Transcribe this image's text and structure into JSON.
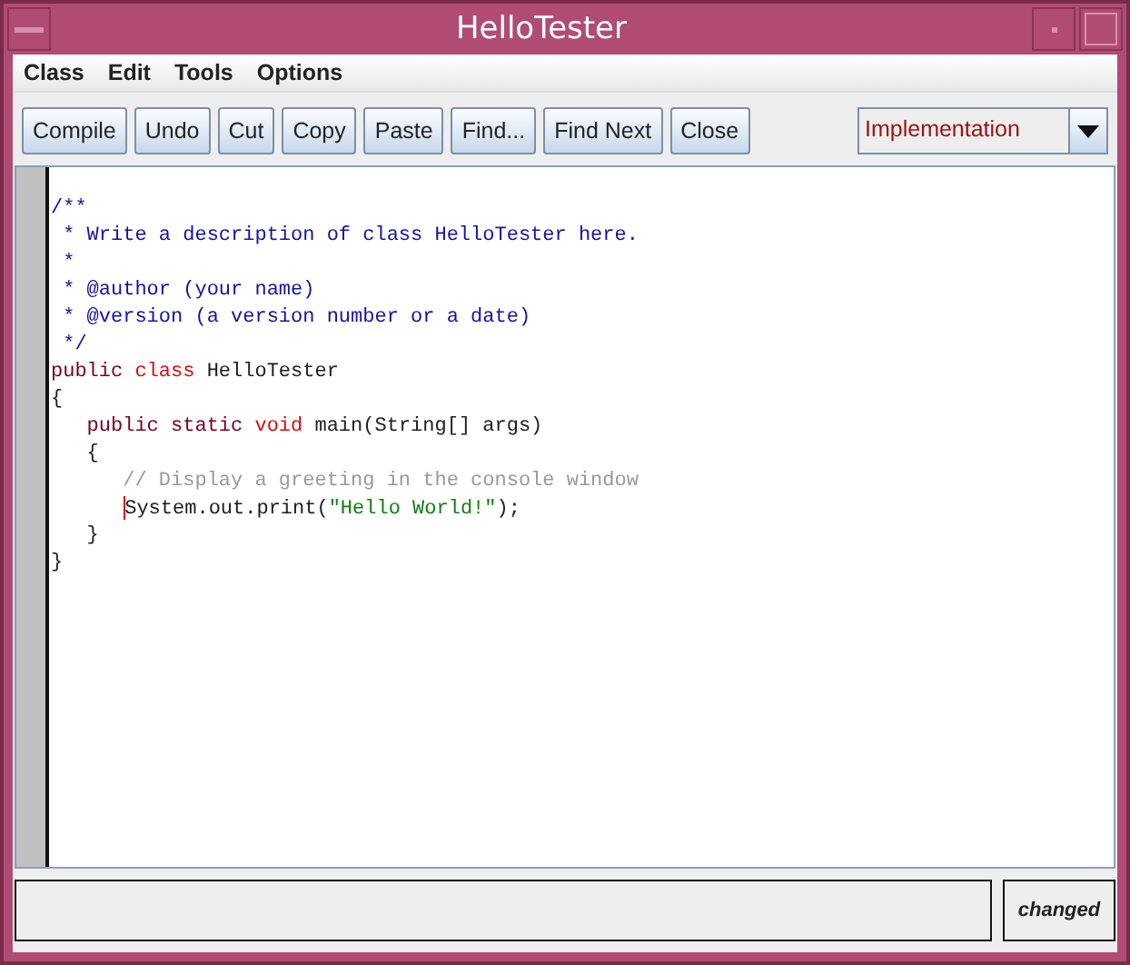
{
  "window": {
    "title": "HelloTester"
  },
  "menu": [
    "Class",
    "Edit",
    "Tools",
    "Options"
  ],
  "toolbar": [
    "Compile",
    "Undo",
    "Cut",
    "Copy",
    "Paste",
    "Find...",
    "Find Next",
    "Close"
  ],
  "view_selector": {
    "value": "Implementation"
  },
  "code": [
    {
      "caret": false,
      "tokens": [
        {
          "kind": "doc",
          "text": "/**"
        }
      ]
    },
    {
      "caret": false,
      "tokens": [
        {
          "kind": "doc",
          "text": " * Write a description of class HelloTester here."
        }
      ]
    },
    {
      "caret": false,
      "tokens": [
        {
          "kind": "doc",
          "text": " *"
        }
      ]
    },
    {
      "caret": false,
      "tokens": [
        {
          "kind": "doc",
          "text": " * @author (your name)"
        }
      ]
    },
    {
      "caret": false,
      "tokens": [
        {
          "kind": "doc",
          "text": " * @version (a version number or a date)"
        }
      ]
    },
    {
      "caret": false,
      "tokens": [
        {
          "kind": "doc",
          "text": " */"
        }
      ]
    },
    {
      "caret": false,
      "tokens": [
        {
          "kind": "keyword",
          "text": "public "
        },
        {
          "kind": "type",
          "text": "class "
        },
        {
          "kind": "plain",
          "text": "HelloTester"
        }
      ]
    },
    {
      "caret": false,
      "tokens": [
        {
          "kind": "plain",
          "text": "{"
        }
      ]
    },
    {
      "caret": false,
      "tokens": [
        {
          "kind": "keyword",
          "text": "   public static "
        },
        {
          "kind": "type",
          "text": "void "
        },
        {
          "kind": "plain",
          "text": "main(String[] args)"
        }
      ]
    },
    {
      "caret": false,
      "tokens": [
        {
          "kind": "plain",
          "text": "   {"
        }
      ]
    },
    {
      "caret": false,
      "tokens": [
        {
          "kind": "comment",
          "text": "      // Display a greeting in the console window"
        }
      ]
    },
    {
      "caret": true,
      "tokens": [
        {
          "kind": "plain",
          "text": "      System.out.print("
        },
        {
          "kind": "string",
          "text": "\"Hello World!\""
        },
        {
          "kind": "plain",
          "text": ");"
        }
      ]
    },
    {
      "caret": false,
      "tokens": [
        {
          "kind": "plain",
          "text": "   }"
        }
      ]
    },
    {
      "caret": false,
      "tokens": [
        {
          "kind": "plain",
          "text": "}"
        }
      ]
    }
  ],
  "status": {
    "state": "changed"
  }
}
